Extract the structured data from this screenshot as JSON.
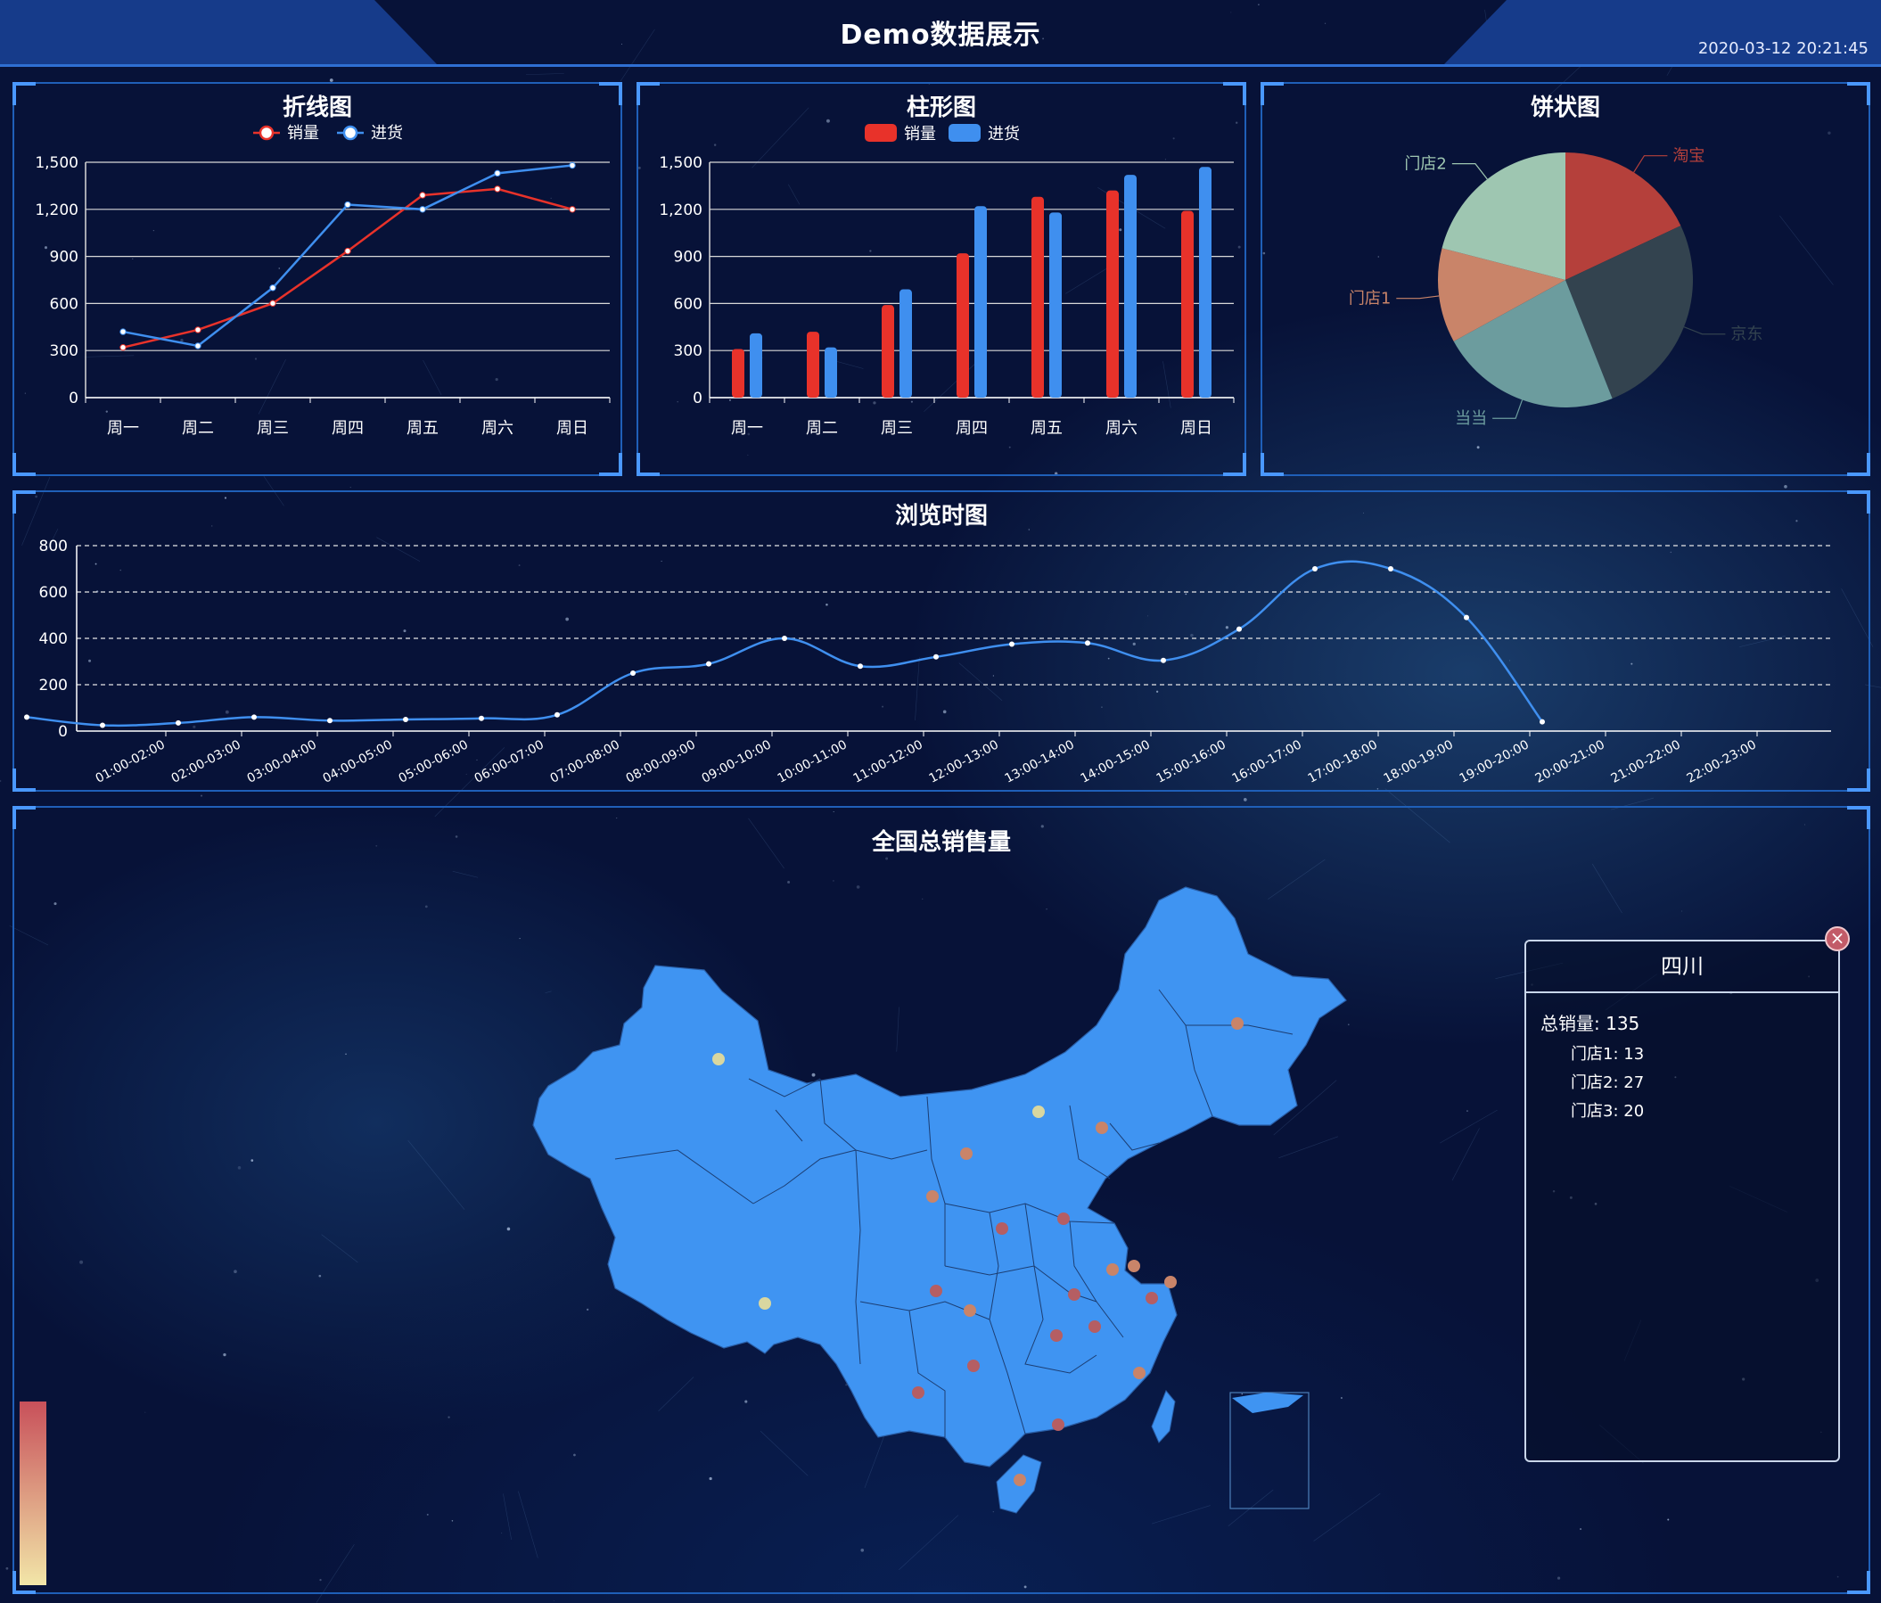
{
  "header": {
    "title": "Demo数据展示",
    "datetime": "2020-03-12 20:21:45"
  },
  "panels": {
    "line": {
      "title": "折线图"
    },
    "bar": {
      "title": "柱形图"
    },
    "pie": {
      "title": "饼状图"
    },
    "browse": {
      "title": "浏览时图"
    },
    "map": {
      "title": "全国总销售量"
    }
  },
  "colors": {
    "sales": "#e8322a",
    "stock": "#3f8fef",
    "browse": "#3f8fef",
    "map_fill": "#3f94f2",
    "panel_border": "#1f5fb8"
  },
  "tooltip": {
    "region": "四川",
    "total_label": "总销量: 135",
    "items": [
      "门店1: 13",
      "门店2: 27",
      "门店3: 20"
    ],
    "close_icon": "close-icon"
  },
  "chart_data": [
    {
      "id": "line",
      "type": "line",
      "title": "折线图",
      "categories": [
        "周一",
        "周二",
        "周三",
        "周四",
        "周五",
        "周六",
        "周日"
      ],
      "series": [
        {
          "name": "销量",
          "values": [
            320,
            432,
            601,
            934,
            1290,
            1330,
            1200
          ]
        },
        {
          "name": "进货",
          "values": [
            420,
            330,
            700,
            1230,
            1200,
            1430,
            1480
          ]
        }
      ],
      "ylim": [
        0,
        1500
      ],
      "yticks": [
        0,
        300,
        600,
        900,
        1200,
        1500
      ],
      "ytick_labels": [
        "0",
        "300",
        "600",
        "900",
        "1,200",
        "1,500"
      ],
      "legend": "top-center",
      "grid": true
    },
    {
      "id": "bar",
      "type": "bar",
      "title": "柱形图",
      "categories": [
        "周一",
        "周二",
        "周三",
        "周四",
        "周五",
        "周六",
        "周日"
      ],
      "series": [
        {
          "name": "销量",
          "values": [
            310,
            420,
            590,
            920,
            1280,
            1320,
            1190
          ]
        },
        {
          "name": "进货",
          "values": [
            410,
            320,
            690,
            1220,
            1180,
            1420,
            1470
          ]
        }
      ],
      "ylim": [
        0,
        1500
      ],
      "yticks": [
        0,
        300,
        600,
        900,
        1200,
        1500
      ],
      "ytick_labels": [
        "0",
        "300",
        "600",
        "900",
        "1,200",
        "1,500"
      ],
      "legend": "top-center",
      "grid": true
    },
    {
      "id": "pie",
      "type": "pie",
      "title": "饼状图",
      "slices": [
        {
          "name": "淘宝",
          "value": 18,
          "color": "#b5403b"
        },
        {
          "name": "京东",
          "value": 26,
          "color": "#33434f"
        },
        {
          "name": "当当",
          "value": 23,
          "color": "#6c9c9e"
        },
        {
          "name": "门店1",
          "value": 12,
          "color": "#c98469"
        },
        {
          "name": "门店2",
          "value": 21,
          "color": "#9ec6b1"
        }
      ]
    },
    {
      "id": "browse",
      "type": "line",
      "title": "浏览时图",
      "categories": [
        "01:00-02:00",
        "02:00-03:00",
        "03:00-04:00",
        "04:00-05:00",
        "05:00-06:00",
        "06:00-07:00",
        "07:00-08:00",
        "08:00-09:00",
        "09:00-10:00",
        "10:00-11:00",
        "11:00-12:00",
        "12:00-13:00",
        "13:00-14:00",
        "14:00-15:00",
        "15:00-16:00",
        "16:00-17:00",
        "17:00-18:00",
        "18:00-19:00",
        "19:00-20:00",
        "20:00-21:00",
        "21:00-22:00",
        "22:00-23:00"
      ],
      "values": [
        60,
        25,
        35,
        60,
        45,
        50,
        55,
        70,
        250,
        290,
        400,
        280,
        320,
        375,
        380,
        305,
        440,
        700,
        700,
        490,
        40
      ],
      "ylim": [
        0,
        800
      ],
      "yticks": [
        0,
        200,
        400,
        600,
        800
      ],
      "grid": true
    },
    {
      "id": "map",
      "type": "map",
      "title": "全国总销售量",
      "visualmap_colors": [
        "#c8505a",
        "#f2e6a8"
      ]
    }
  ]
}
